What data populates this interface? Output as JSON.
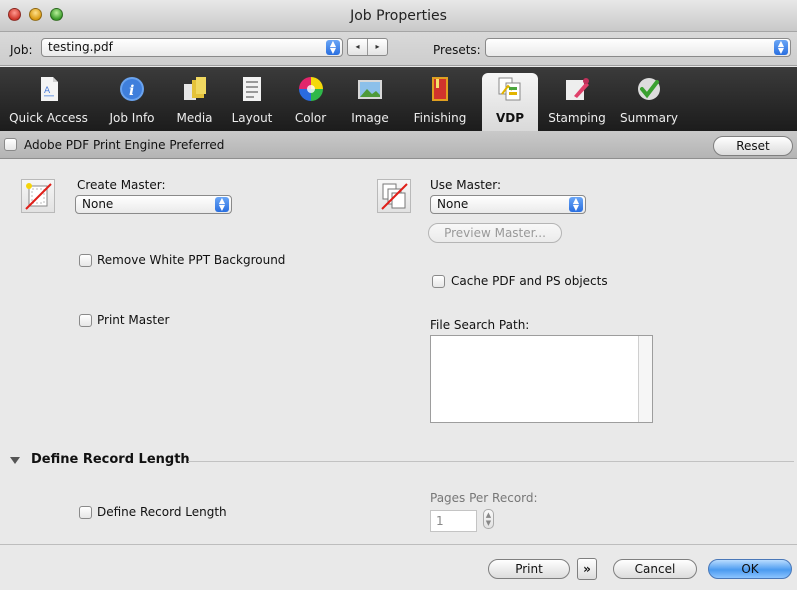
{
  "window": {
    "title": "Job Properties"
  },
  "job": {
    "label": "Job:",
    "value": "testing.pdf",
    "nav_prev": "◂",
    "nav_next": "▸",
    "presets_label": "Presets:",
    "presets_value": ""
  },
  "toolbar": {
    "tabs": [
      {
        "label": "Quick Access",
        "icon": "quick-access-icon"
      },
      {
        "label": "Job Info",
        "icon": "info-icon"
      },
      {
        "label": "Media",
        "icon": "media-icon"
      },
      {
        "label": "Layout",
        "icon": "layout-icon"
      },
      {
        "label": "Color",
        "icon": "color-wheel-icon"
      },
      {
        "label": "Image",
        "icon": "image-icon"
      },
      {
        "label": "Finishing",
        "icon": "finishing-icon"
      },
      {
        "label": "VDP",
        "icon": "vdp-icon",
        "active": true
      },
      {
        "label": "Stamping",
        "icon": "stamping-icon"
      },
      {
        "label": "Summary",
        "icon": "summary-checkmark-icon"
      }
    ]
  },
  "engine": {
    "checkbox_label": "Adobe PDF Print Engine Preferred",
    "reset_label": "Reset"
  },
  "create_master": {
    "label": "Create Master:",
    "value": "None"
  },
  "use_master": {
    "label": "Use Master:",
    "value": "None",
    "preview_label": "Preview Master..."
  },
  "options": {
    "remove_white_ppt": "Remove White PPT Background",
    "print_master": "Print Master",
    "cache_pdf_ps": "Cache PDF and PS objects",
    "file_search_path": "File Search Path:"
  },
  "record_length": {
    "section_title": "Define Record Length",
    "checkbox_label": "Define Record Length",
    "pages_per_record_label": "Pages Per Record:",
    "pages_per_record_value": "1"
  },
  "footer": {
    "print_label": "Print",
    "more_label": "»",
    "cancel_label": "Cancel",
    "ok_label": "OK"
  },
  "colors": {
    "accent": "#2a6fe0",
    "toolbar_bg": "#262626",
    "dialog_bg": "#e9e9e9"
  }
}
